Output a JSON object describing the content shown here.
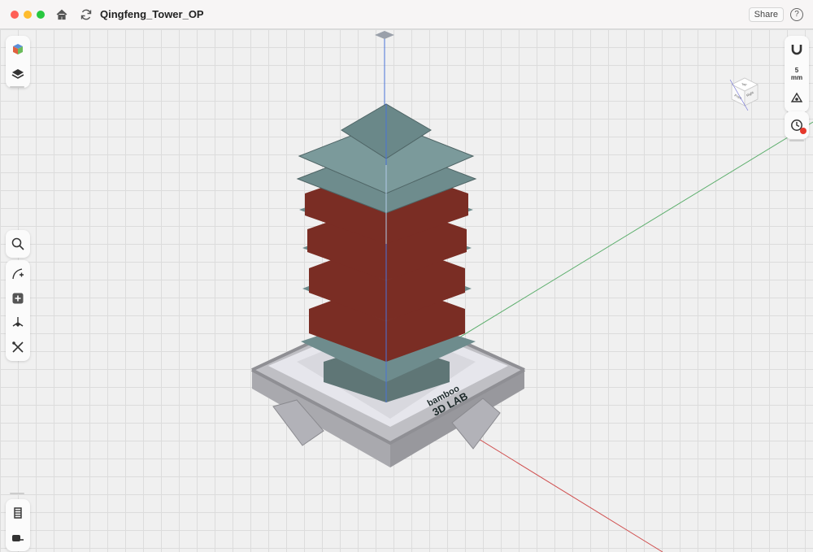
{
  "window": {
    "title": "Qingfeng_Tower_OP"
  },
  "toolbar": {
    "share_label": "Share",
    "help_label": "?"
  },
  "right_panel": {
    "unit_value": "5",
    "unit_label": "mm"
  },
  "viewcube": {
    "top": "Top",
    "front": "Front",
    "right": "Right"
  },
  "model": {
    "logo_line1": "bamboo",
    "logo_line2": "3D LAB"
  },
  "icons": {
    "left_top": [
      "cube-color-icon",
      "layers-icon"
    ],
    "left_mid": [
      "search-icon",
      "curve-add-icon",
      "add-box-icon",
      "transform-icon",
      "tools-icon"
    ],
    "left_bottom": [
      "slice-icon",
      "measure-tape-icon"
    ],
    "right": [
      "magnet-icon",
      "unit-mm",
      "origin-icon",
      "history-icon"
    ]
  },
  "colors": {
    "roof": "#6e8c8d",
    "walls": "#7a2d24",
    "base": "#cfcfd2",
    "axis_x": "#d05050",
    "axis_y": "#5cae6c",
    "axis_z": "#4a73d8"
  }
}
